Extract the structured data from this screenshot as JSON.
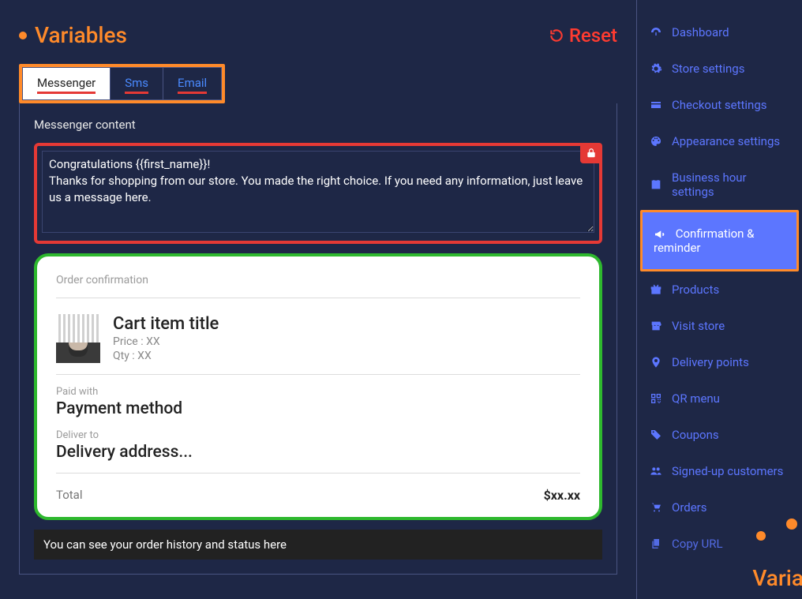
{
  "header": {
    "title": "Variables",
    "reset": "Reset"
  },
  "tabs": [
    {
      "label": "Messenger",
      "active": true
    },
    {
      "label": "Sms",
      "active": false
    },
    {
      "label": "Email",
      "active": false
    }
  ],
  "section_label": "Messenger content",
  "editor_value": "Congratulations {{first_name}}!\nThanks for shopping from our store. You made the right choice. If you need any information, just leave us a message here.",
  "order": {
    "title": "Order confirmation",
    "item_title": "Cart item title",
    "price_label": "Price : XX",
    "qty_label": "Qty : XX",
    "paid_label": "Paid with",
    "paid_value": "Payment method",
    "deliver_label": "Deliver to",
    "deliver_value": "Delivery address...",
    "total_label": "Total",
    "total_value": "$xx.xx"
  },
  "history_text": "You can see your order history and status here",
  "sidebar": {
    "items": [
      {
        "label": "Dashboard",
        "icon": "dashboard"
      },
      {
        "label": "Store settings",
        "icon": "gear"
      },
      {
        "label": "Checkout settings",
        "icon": "card"
      },
      {
        "label": "Appearance settings",
        "icon": "palette"
      },
      {
        "label": "Business hour settings",
        "icon": "calendar"
      },
      {
        "label": "Confirmation & reminder",
        "icon": "megaphone",
        "active": true
      },
      {
        "label": "Products",
        "icon": "gift"
      },
      {
        "label": "Visit store",
        "icon": "store"
      },
      {
        "label": "Delivery points",
        "icon": "pin"
      },
      {
        "label": "QR menu",
        "icon": "qr"
      },
      {
        "label": "Coupons",
        "icon": "tags"
      },
      {
        "label": "Signed-up customers",
        "icon": "users"
      },
      {
        "label": "Orders",
        "icon": "cart"
      },
      {
        "label": "Copy URL",
        "icon": "copy"
      }
    ]
  },
  "floating_label": "Varia"
}
